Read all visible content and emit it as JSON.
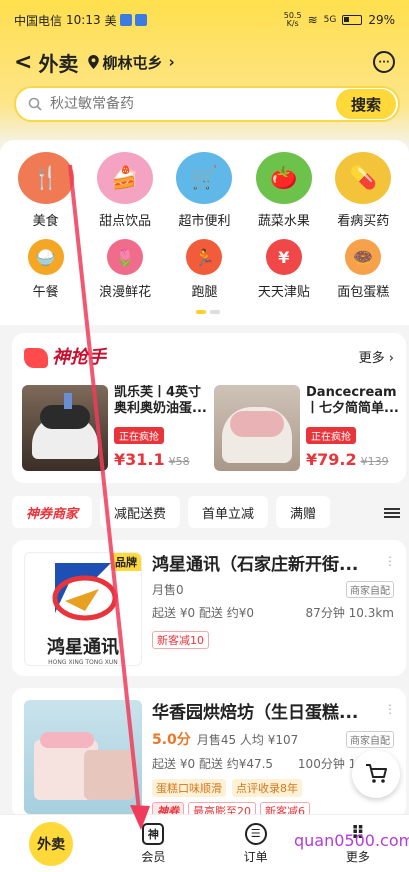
{
  "status": {
    "carrier": "中国电信",
    "time": "10:13",
    "app": "美",
    "net_speed": "50.5\nK/s",
    "signal": "5G",
    "battery": "29%"
  },
  "header": {
    "title": "外卖",
    "location": "柳林屯乡"
  },
  "search": {
    "placeholder": "秋过敏常备药",
    "button": "搜索"
  },
  "categories_main": [
    {
      "label": "美食",
      "color": "#f07a54",
      "glyph": "🍴"
    },
    {
      "label": "甜点饮品",
      "color": "#f5a3c2",
      "glyph": "🍰"
    },
    {
      "label": "超市便利",
      "color": "#5fb8e8",
      "glyph": "🛒"
    },
    {
      "label": "蔬菜水果",
      "color": "#6cc24a",
      "glyph": "🍅"
    },
    {
      "label": "看病买药",
      "color": "#f3c43a",
      "glyph": "💊"
    }
  ],
  "categories_small": [
    {
      "label": "午餐",
      "color": "#f5a623",
      "glyph": "🍚"
    },
    {
      "label": "浪漫鲜花",
      "color": "#f06c8b",
      "glyph": "🌷"
    },
    {
      "label": "跑腿",
      "color": "#f25c3a",
      "glyph": "🏃"
    },
    {
      "label": "天天津贴",
      "color": "#f04848",
      "glyph": "¥"
    },
    {
      "label": "面包蛋糕",
      "color": "#f7a24a",
      "glyph": "🍩"
    }
  ],
  "flash": {
    "title": "神抢手",
    "more": "更多 ›",
    "deals": [
      {
        "name": "凯乐芙丨4英寸奥利奥奶油蛋...",
        "tag": "正在疯抢",
        "price": "¥31.1",
        "orig": "¥58"
      },
      {
        "name": "Dancecream丨七夕简简单...",
        "tag": "正在疯抢",
        "price": "¥79.2",
        "orig": "¥139"
      }
    ]
  },
  "filters": [
    "神券商家",
    "减配送费",
    "首单立减",
    "满赠"
  ],
  "shops": [
    {
      "brand_tag": "品牌",
      "name": "鸿星通讯（石家庄新开街...",
      "sales": "月售0",
      "badge": "商家自配",
      "delivery": "起送 ¥0  配送 约¥0",
      "time_dist": "87分钟  10.3km",
      "promo": "新客减10",
      "logo_text": "鸿星通讯",
      "logo_sub": "HONG XING TONG XUN"
    },
    {
      "name": "华香园烘焙坊（生日蛋糕...",
      "score": "5.0分",
      "sales": "月售45  人均 ¥107",
      "badge": "商家自配",
      "delivery": "起送 ¥0  配送 约¥47.5",
      "time_dist": "100分钟  18.3km",
      "tags": [
        "蛋糕口味顺滑",
        "点评收录8年"
      ],
      "promos": [
        "神券",
        "最高膨至20",
        "新客减6"
      ]
    }
  ],
  "bottom_nav": [
    {
      "label": "外卖"
    },
    {
      "label": "会员",
      "glyph": "神"
    },
    {
      "label": "订单",
      "glyph": "☰"
    },
    {
      "label": "更多",
      "glyph": "⠿"
    }
  ],
  "watermark": "quan0500.com"
}
